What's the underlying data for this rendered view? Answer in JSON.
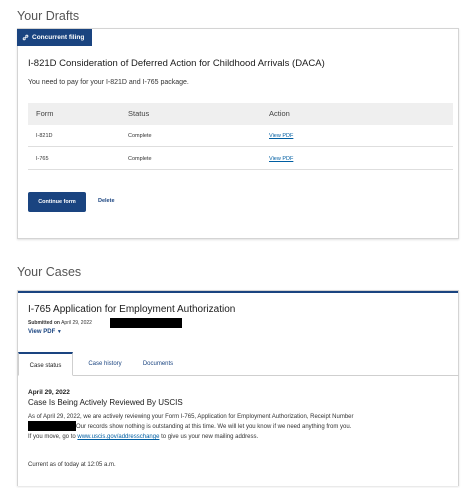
{
  "drafts": {
    "heading": "Your Drafts",
    "badge_label": "Concurrent filing",
    "title": "I-821D Consideration of Deferred Action for Childhood Arrivals (DACA)",
    "subtitle": "You need to pay for your I-821D and I-765 package.",
    "table": {
      "columns": [
        "Form",
        "Status",
        "Action"
      ],
      "rows": [
        {
          "form": "I-821D",
          "status": "Complete",
          "action": "View PDF"
        },
        {
          "form": "I-765",
          "status": "Complete",
          "action": "View PDF"
        }
      ]
    },
    "continue_label": "Continue form",
    "delete_label": "Delete"
  },
  "cases": {
    "heading": "Your Cases",
    "title": "I-765 Application for Employment Authorization",
    "submitted_prefix": "Submitted on",
    "submitted_date": "April 29, 2022",
    "view_pdf_label": "View PDF",
    "tabs": [
      "Case status",
      "Case history",
      "Documents"
    ],
    "status": {
      "date": "April 29, 2022",
      "headline": "Case Is Being Actively Reviewed By USCIS",
      "line1": "As of April 29, 2022, we are actively reviewing your Form I-765, Application for Employment Authorization, Receipt Number",
      "line2": "Our records show nothing is outstanding at this time. We will let you know if we need anything from you.",
      "line3_prefix": "If you move, go to",
      "line3_link": "www.uscis.gov/addresschange",
      "line3_suffix": "to give us your new mailing address.",
      "current_as_of": "Current as of today at 12:05 a.m."
    }
  },
  "colors": {
    "primary": "#1a4480",
    "link": "#005ea2",
    "table_header_bg": "#efefef"
  }
}
